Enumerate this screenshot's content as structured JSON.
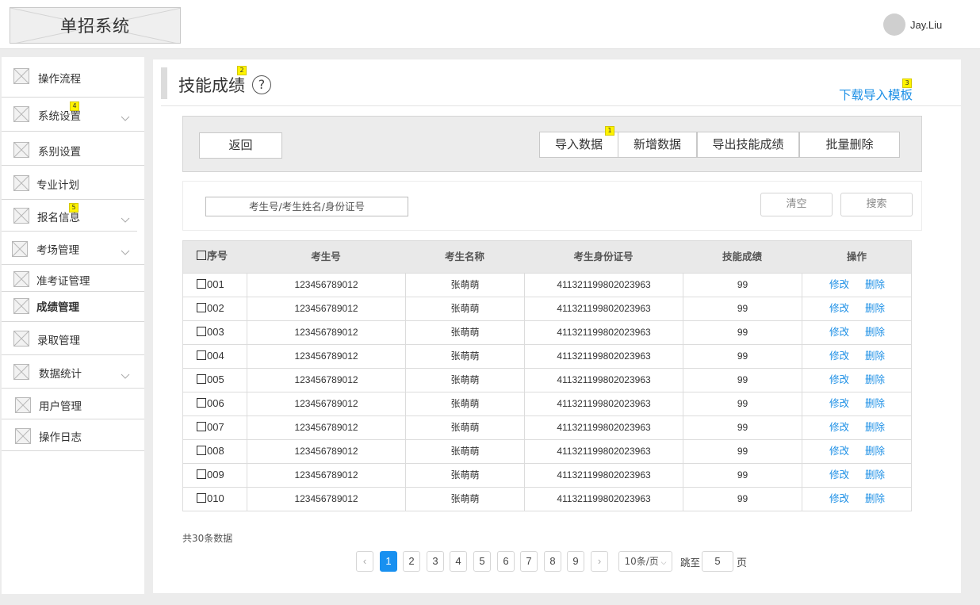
{
  "header": {
    "logo_text": "单招系统",
    "username": "Jay.Liu"
  },
  "sidebar": {
    "items": [
      {
        "label": "操作流程",
        "expandable": false,
        "bold": false
      },
      {
        "label": "系统设置",
        "expandable": true,
        "bold": false,
        "tag": "4"
      },
      {
        "label": "系别设置",
        "expandable": false,
        "bold": false
      },
      {
        "label": "专业计划",
        "expandable": false,
        "bold": false
      },
      {
        "label": "报名信息",
        "expandable": true,
        "bold": false,
        "tag": "5"
      },
      {
        "label": "考场管理",
        "expandable": true,
        "bold": false
      },
      {
        "label": "准考证管理",
        "expandable": false,
        "bold": false
      },
      {
        "label": "成绩管理",
        "expandable": false,
        "bold": true
      },
      {
        "label": "录取管理",
        "expandable": false,
        "bold": false
      },
      {
        "label": "数据统计",
        "expandable": true,
        "bold": false
      },
      {
        "label": "用户管理",
        "expandable": false,
        "bold": false
      },
      {
        "label": "操作日志",
        "expandable": false,
        "bold": false
      }
    ]
  },
  "page": {
    "title": "技能成绩",
    "title_tag": "2",
    "help_symbol": "?",
    "download_template": "下载导入模板",
    "download_tag": "3"
  },
  "toolbar": {
    "back": "返回",
    "import": "导入数据",
    "import_tag": "1",
    "add": "新增数据",
    "export": "导出技能成绩",
    "batch_delete": "批量删除"
  },
  "search": {
    "placeholder": "考生号/考生姓名/身份证号",
    "clear": "清空",
    "search": "搜索"
  },
  "table": {
    "headers": [
      "序号",
      "考生号",
      "考生名称",
      "考生身份证号",
      "技能成绩",
      "操作"
    ],
    "edit_label": "修改",
    "delete_label": "删除",
    "rows": [
      {
        "no": "001",
        "exam_no": "123456789012",
        "name": "张萌萌",
        "id_card": "41132119980202396​3",
        "score": "99"
      },
      {
        "no": "002",
        "exam_no": "123456789012",
        "name": "张萌萌",
        "id_card": "411321199802023963",
        "score": "99"
      },
      {
        "no": "003",
        "exam_no": "123456789012",
        "name": "张萌萌",
        "id_card": "411321199802023963",
        "score": "99"
      },
      {
        "no": "004",
        "exam_no": "123456789012",
        "name": "张萌萌",
        "id_card": "411321199802023963",
        "score": "99"
      },
      {
        "no": "005",
        "exam_no": "123456789012",
        "name": "张萌萌",
        "id_card": "411321199802023963",
        "score": "99"
      },
      {
        "no": "006",
        "exam_no": "123456789012",
        "name": "张萌萌",
        "id_card": "411321199802023963",
        "score": "99"
      },
      {
        "no": "007",
        "exam_no": "123456789012",
        "name": "张萌萌",
        "id_card": "411321199802023963",
        "score": "99"
      },
      {
        "no": "008",
        "exam_no": "123456789012",
        "name": "张萌萌",
        "id_card": "411321199802023963",
        "score": "99"
      },
      {
        "no": "009",
        "exam_no": "123456789012",
        "name": "张萌萌",
        "id_card": "411321199802023963",
        "score": "99"
      },
      {
        "no": "010",
        "exam_no": "123456789012",
        "name": "张萌萌",
        "id_card": "411321199802023963",
        "score": "99"
      }
    ]
  },
  "pagination": {
    "total": "共30条数据",
    "prev": "‹",
    "next": "›",
    "pages": [
      "1",
      "2",
      "3",
      "4",
      "5",
      "6",
      "7",
      "8",
      "9"
    ],
    "current": "1",
    "page_size": "10条/页",
    "jump_label": "跳至",
    "jump_value": "5",
    "page_unit": "页"
  },
  "colors": {
    "accent": "#1890f0",
    "link": "#1e90e6",
    "tag": "#fff300"
  }
}
